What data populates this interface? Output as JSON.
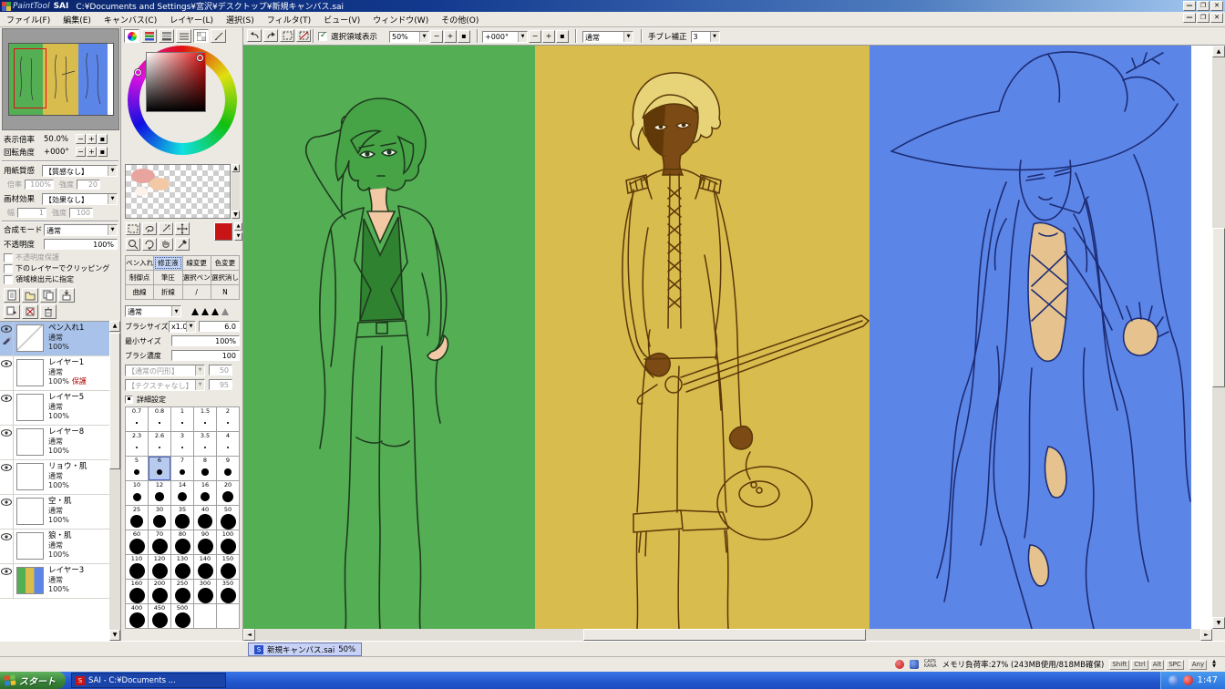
{
  "titlebar": {
    "app": "PaintTool",
    "app2": "SAI",
    "title": "C:¥Documents and Settings¥宮沢¥デスクトップ¥新規キャンバス.sai"
  },
  "menubar": {
    "items": [
      "ファイル(F)",
      "編集(E)",
      "キャンバス(C)",
      "レイヤー(L)",
      "選択(S)",
      "フィルタ(T)",
      "ビュー(V)",
      "ウィンドウ(W)",
      "その他(O)"
    ]
  },
  "toolbar": {
    "show_selection_label": "選択領域表示",
    "zoom_value": "50%",
    "angle_value": "+000°",
    "blend_value": "通常",
    "stabilizer_label": "手ブレ補正",
    "stabilizer_value": "3"
  },
  "navigator": {
    "zoom_label": "表示倍率",
    "zoom_value": "50.0%",
    "angle_label": "回転角度",
    "angle_value": "+000°"
  },
  "canvas_props": {
    "paper_label": "用紙質感",
    "paper_value": "【質感なし】",
    "paper_scale_label": "倍率",
    "paper_scale_value": "100%",
    "paper_strength_label": "強度",
    "paper_strength_value": "20",
    "effect_label": "画材効果",
    "effect_value": "【効果なし】",
    "effect_width_label": "幅",
    "effect_width_value": "1",
    "effect_strength_label": "強度",
    "effect_strength_value": "100"
  },
  "layer_props": {
    "blend_label": "合成モード",
    "blend_value": "通常",
    "opacity_label": "不透明度",
    "opacity_value": "100%",
    "lock_opacity_label": "不透明度保護",
    "clipping_label": "下のレイヤーでクリッピング",
    "selection_source_label": "領域検出元に指定"
  },
  "layers": [
    {
      "name": "ペン入れ1",
      "mode": "通常",
      "opacity": "100%",
      "selected": true,
      "thumb": "pen",
      "badge": ""
    },
    {
      "name": "レイヤー1",
      "mode": "通常",
      "opacity": "100%",
      "thumb": "plain",
      "badge": "保護"
    },
    {
      "name": "レイヤー5",
      "mode": "通常",
      "opacity": "100%",
      "thumb": "plain",
      "badge": ""
    },
    {
      "name": "レイヤー8",
      "mode": "通常",
      "opacity": "100%",
      "thumb": "plain",
      "badge": ""
    },
    {
      "name": "リョウ・肌",
      "mode": "通常",
      "opacity": "100%",
      "thumb": "plain",
      "badge": ""
    },
    {
      "name": "空・肌",
      "mode": "通常",
      "opacity": "100%",
      "thumb": "plain",
      "badge": ""
    },
    {
      "name": "狼・肌",
      "mode": "通常",
      "opacity": "100%",
      "thumb": "plain",
      "badge": ""
    },
    {
      "name": "レイヤー3",
      "mode": "通常",
      "opacity": "100%",
      "thumb": "stripes",
      "badge": ""
    }
  ],
  "tools": {
    "cells": [
      {
        "label": "ペン入れ"
      },
      {
        "label": "修正液",
        "selected": true
      },
      {
        "label": "線変更"
      },
      {
        "label": "色変更"
      },
      {
        "label": "制御点"
      },
      {
        "label": "筆圧"
      },
      {
        "label": "選択ペン"
      },
      {
        "label": "選択消し"
      },
      {
        "label": "曲線"
      },
      {
        "label": "折線"
      },
      {
        "label": "/"
      },
      {
        "label": "N"
      }
    ]
  },
  "brush": {
    "mode_value": "通常",
    "size_label": "ブラシサイズ",
    "size_unit": "x1.0",
    "size_value": "6.0",
    "min_size_label": "最小サイズ",
    "min_size_value": "100%",
    "density_label": "ブラシ濃度",
    "density_value": "100",
    "shape_value": "【通常の円形】",
    "shape_strength": "50",
    "texture_value": "【テクスチャなし】",
    "texture_strength": "95",
    "detail_label": "詳細設定",
    "sizes": [
      "0.7",
      "0.8",
      "1",
      "1.5",
      "2",
      "2.3",
      "2.6",
      "3",
      "3.5",
      "4",
      "5",
      "6",
      "7",
      "8",
      "9",
      "10",
      "12",
      "14",
      "16",
      "20",
      "25",
      "30",
      "35",
      "40",
      "50",
      "60",
      "70",
      "80",
      "90",
      "100",
      "110",
      "120",
      "130",
      "140",
      "150",
      "160",
      "200",
      "250",
      "300",
      "350",
      "400",
      "450",
      "500"
    ],
    "selected_size": "6"
  },
  "canvas_tab": {
    "name": "新規キャンバス.sai",
    "zoom": "50%"
  },
  "statusbar": {
    "ime_caps": "CAPS",
    "ime_kana": "KANA",
    "memory": "メモリ負荷率:27% (243MB使用/818MB確保)",
    "keys": [
      "Shift",
      "Ctrl",
      "Alt",
      "SPC"
    ],
    "any": "Any"
  },
  "taskbar": {
    "start": "スタート",
    "task": "SAI - C:¥Documents ...",
    "clock": "1:47"
  },
  "colors": {
    "panel_green": "#54ae54",
    "panel_yellow": "#d8bc4e",
    "panel_blue": "#5c85e8",
    "canvas_white": "#ffffff",
    "skin_light": "#f2c9a4",
    "skin_dark": "#7c4a14",
    "skin_tan": "#e6c38e",
    "current_color": "#c81414"
  }
}
